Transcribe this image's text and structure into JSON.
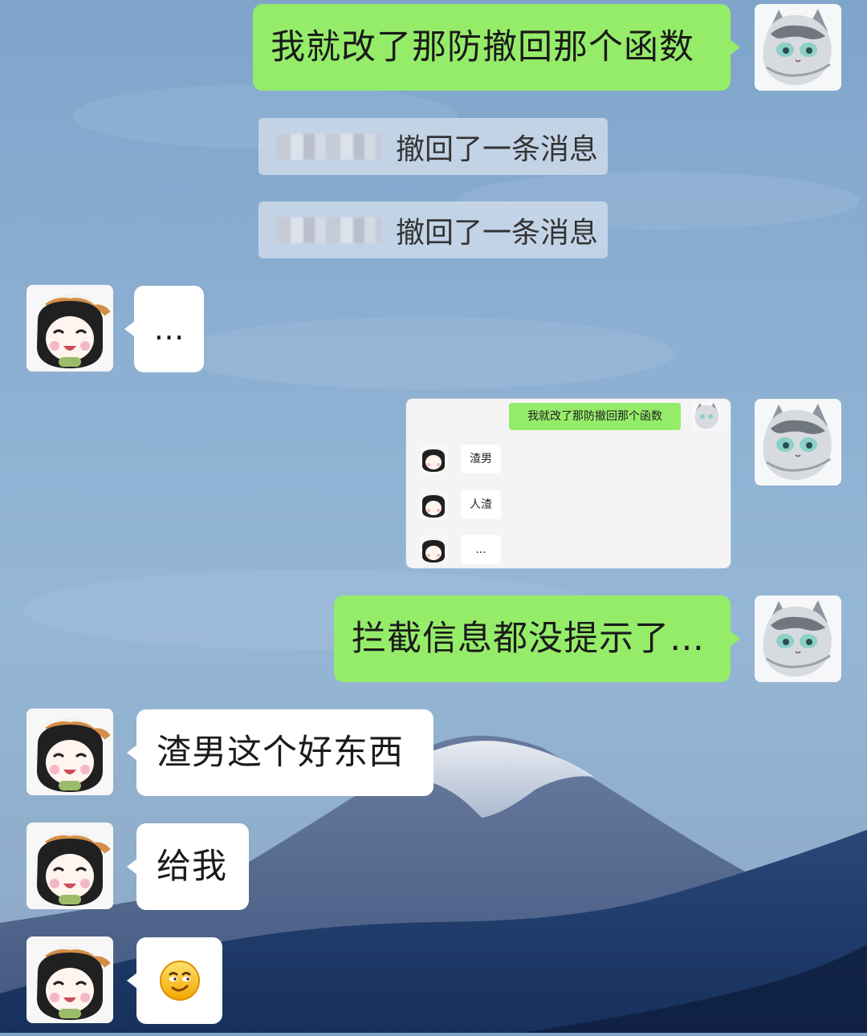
{
  "messages": {
    "m1": {
      "text": "我就改了那防撤回那个函数"
    },
    "m2": {
      "text": "撤回了一条消息"
    },
    "m3": {
      "text": "撤回了一条消息"
    },
    "m4": {
      "text": "…"
    },
    "m5": {
      "quoted_line": "我就改了那防撤回那个函数",
      "reply_1": "渣男",
      "reply_2": "人渣",
      "reply_3": "..."
    },
    "m6": {
      "text": "拦截信息都没提示了…"
    },
    "m7": {
      "text": "渣男这个好东西"
    },
    "m8": {
      "text": "给我"
    },
    "m9": {
      "emoji": "smirk-emoji"
    }
  },
  "colors": {
    "self_bubble": "#95ec69",
    "other_bubble": "#ffffff",
    "system_bubble": "#cddaea"
  }
}
